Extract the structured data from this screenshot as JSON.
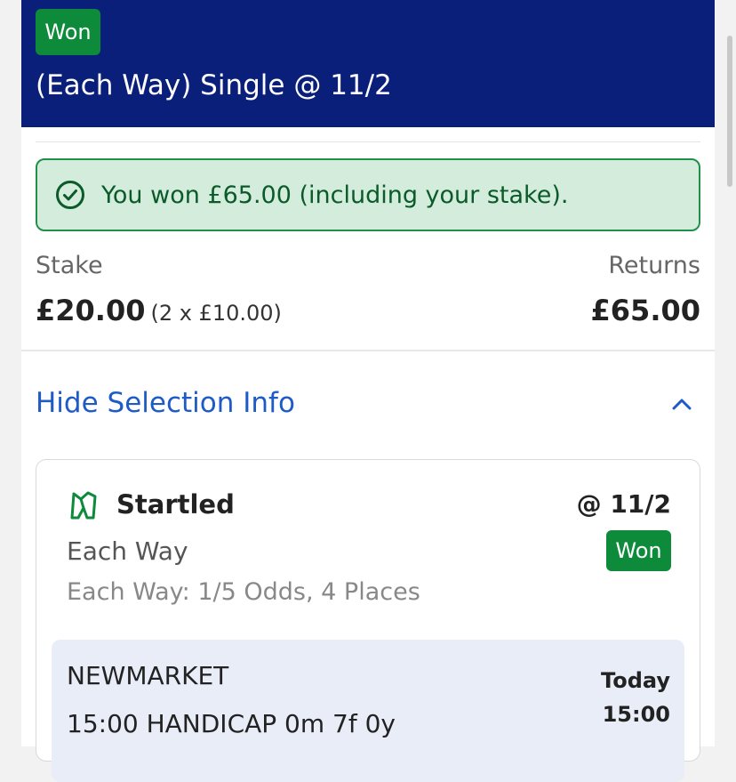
{
  "header": {
    "status_badge": "Won",
    "bet_title": "(Each Way) Single @ 11/2"
  },
  "win_banner": {
    "text": "You won £65.00 (including your stake)."
  },
  "summary": {
    "stake_label": "Stake",
    "stake_value": "£20.00",
    "stake_detail": "(2 x £10.00)",
    "returns_label": "Returns",
    "returns_value": "£65.00"
  },
  "selection_toggle": {
    "label": "Hide Selection Info"
  },
  "selection": {
    "horse_name": "Startled",
    "odds": "@ 11/2",
    "bet_type": "Each Way",
    "each_way_terms": "Each Way: 1/5 Odds, 4 Places",
    "status_badge": "Won",
    "event": {
      "venue": "NEWMARKET",
      "race": "15:00 HANDICAP 0m 7f 0y",
      "day": "Today",
      "time": "15:00"
    }
  },
  "colors": {
    "header_bg": "#0a1f7a",
    "won_green": "#0d8a3a",
    "banner_bg": "#d4ecdc",
    "link_blue": "#1f5bc7"
  },
  "icons": [
    "check-circle-icon",
    "chevron-up-icon",
    "horse-racing-icon"
  ]
}
